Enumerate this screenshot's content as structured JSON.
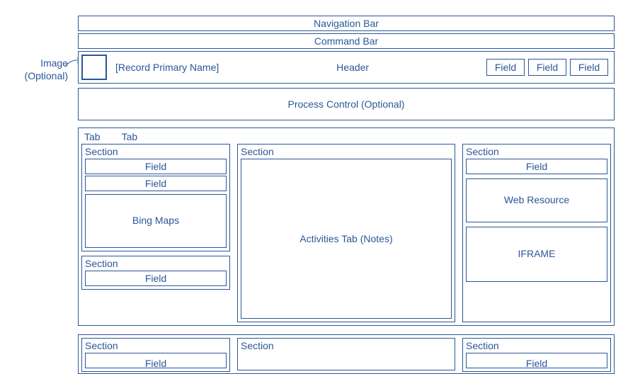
{
  "annotation": {
    "line1": "Image",
    "line2": "(Optional)"
  },
  "nav_bar": "Navigation Bar",
  "command_bar": "Command Bar",
  "header": {
    "primary_name": "[Record Primary Name]",
    "label": "Header",
    "fields": [
      "Field",
      "Field",
      "Field"
    ]
  },
  "process_control": "Process Control (Optional)",
  "tabs": [
    "Tab",
    "Tab"
  ],
  "left_col": {
    "section1": {
      "title": "Section",
      "field1": "Field",
      "field2": "Field",
      "maps": "Bing Maps"
    },
    "section2": {
      "title": "Section",
      "field1": "Field"
    }
  },
  "mid_col": {
    "section": {
      "title": "Section",
      "activities": "Activities Tab (Notes)"
    }
  },
  "right_col": {
    "section": {
      "title": "Section",
      "field1": "Field",
      "webres": "Web Resource",
      "iframe": "IFRAME"
    }
  },
  "bottom": {
    "s1": {
      "title": "Section",
      "field": "Field"
    },
    "s2": {
      "title": "Section"
    },
    "s3": {
      "title": "Section",
      "field": "Field"
    }
  }
}
